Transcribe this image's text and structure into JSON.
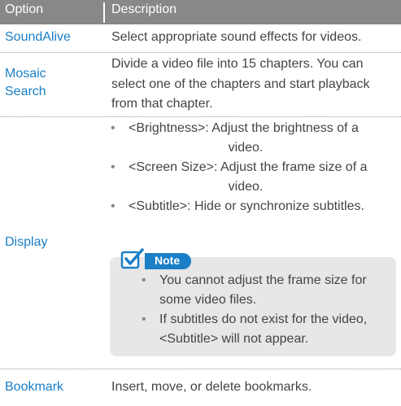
{
  "header": {
    "option": "Option",
    "description": "Description"
  },
  "rows": [
    {
      "option_lines": [
        "SoundAlive"
      ],
      "description_lines": [
        "Select appropriate sound effects for videos."
      ]
    },
    {
      "option_lines": [
        "Mosaic",
        "Search"
      ],
      "description_lines": [
        "Divide a video file into 15 chapters. You can",
        "select one of the chapters and start playback",
        "from that chapter."
      ]
    },
    {
      "option_lines": [
        "Display"
      ],
      "bullets": [
        {
          "first": "<Brightness>: Adjust the brightness of a",
          "cont": "video."
        },
        {
          "first": "<Screen Size>: Adjust the frame size of a",
          "cont": "video."
        },
        {
          "first": "<Subtitle>: Hide or synchronize subtitles.",
          "cont": ""
        }
      ],
      "note": {
        "label": "Note",
        "items": [
          {
            "lines": [
              "You cannot adjust the frame size for",
              "some video files."
            ]
          },
          {
            "lines": [
              "If subtitles do not exist for the video,",
              "<Subtitle> will not appear."
            ]
          }
        ]
      }
    },
    {
      "option_lines": [
        "Bookmark"
      ],
      "description_lines": [
        "Insert, move, or delete bookmarks."
      ]
    }
  ],
  "colors": {
    "header_bg": "#888888",
    "option_text": "#1a7fc6",
    "note_bg": "#e7e7e7",
    "note_accent": "#1a7fc6"
  },
  "icons": [
    "bullet-dot-icon",
    "note-checkbox-icon"
  ]
}
